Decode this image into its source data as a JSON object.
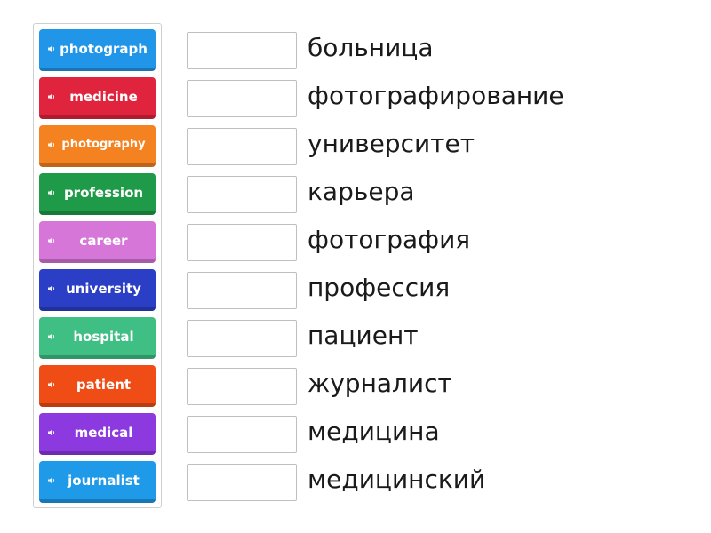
{
  "tiles": [
    {
      "label": "photograph",
      "color": "#2196e8",
      "icon": "speaker-icon"
    },
    {
      "label": "medicine",
      "color": "#e0243d",
      "icon": "speaker-icon"
    },
    {
      "label": "photography",
      "color": "#f58220",
      "icon": "speaker-icon"
    },
    {
      "label": "profession",
      "color": "#1f9a48",
      "icon": "speaker-icon"
    },
    {
      "label": "career",
      "color": "#d676d8",
      "icon": "speaker-icon"
    },
    {
      "label": "university",
      "color": "#2a3fc6",
      "icon": "speaker-icon"
    },
    {
      "label": "hospital",
      "color": "#3fbf84",
      "icon": "speaker-icon"
    },
    {
      "label": "patient",
      "color": "#f04d16",
      "icon": "speaker-icon"
    },
    {
      "label": "medical",
      "color": "#8c39e0",
      "icon": "speaker-icon"
    },
    {
      "label": "journalist",
      "color": "#1f9ae8",
      "icon": "speaker-icon"
    }
  ],
  "targets": [
    {
      "word": "больница"
    },
    {
      "word": "фотографирование"
    },
    {
      "word": "университет"
    },
    {
      "word": "карьера"
    },
    {
      "word": "фотография"
    },
    {
      "word": "профессия"
    },
    {
      "word": "пациент"
    },
    {
      "word": "журналист"
    },
    {
      "word": "медицина"
    },
    {
      "word": "медицинский"
    }
  ]
}
